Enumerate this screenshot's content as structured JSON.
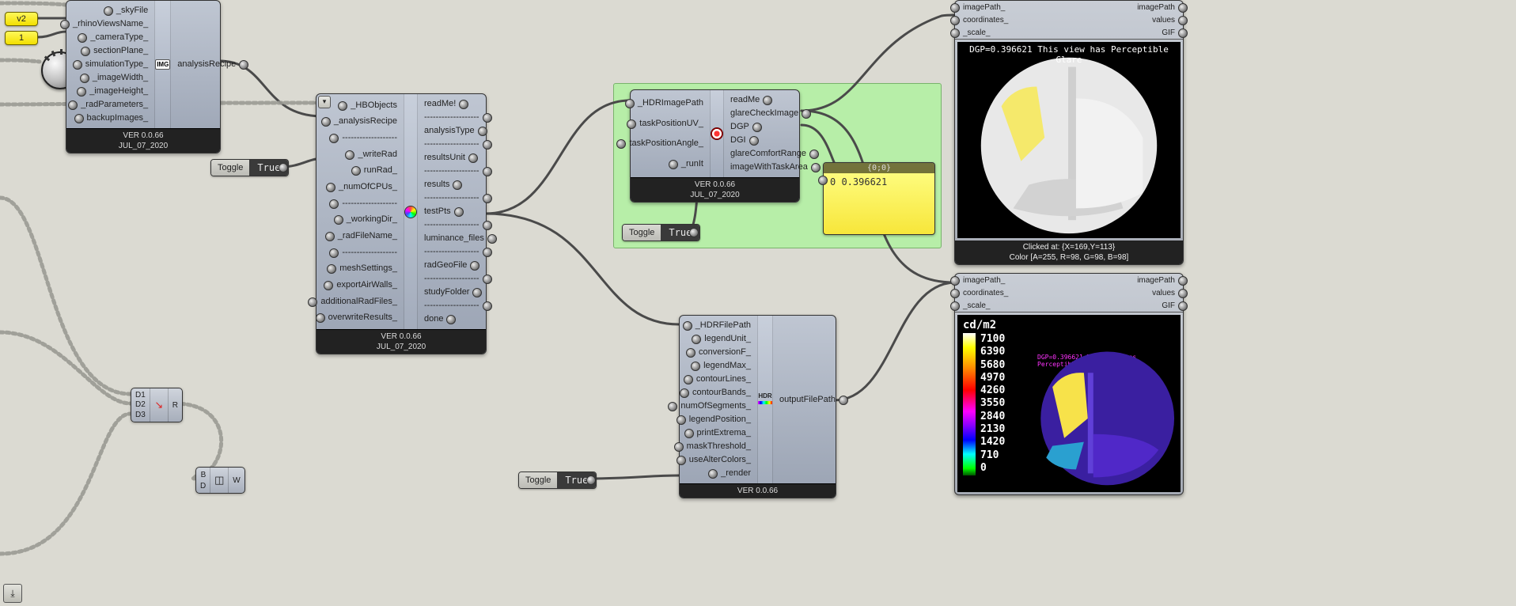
{
  "version": "VER 0.0.66",
  "date": "JUL_07_2020",
  "caps": {
    "v2": "v2",
    "one": "1"
  },
  "toggles": {
    "label": "Toggle",
    "val": "True"
  },
  "node1": {
    "in": [
      "_skyFile",
      "_rhinoViewsName_",
      "_cameraType_",
      "sectionPlane_",
      "simulationType_",
      "_imageWidth_",
      "_imageHeight_",
      "_radParameters_",
      "backupImages_"
    ],
    "out": [
      "analysisRecipe"
    ]
  },
  "node2": {
    "in": [
      "_HBObjects",
      "_analysisRecipe",
      "-------------------",
      "_writeRad",
      "runRad_",
      "_numOfCPUs_",
      "-------------------",
      "_workingDir_",
      "_radFileName_",
      "-------------------",
      "meshSettings_",
      "exportAirWalls_",
      "additionalRadFiles_",
      "overwriteResults_"
    ],
    "out": [
      "readMe!",
      "-------------------",
      "analysisType",
      "-------------------",
      "resultsUnit",
      "-------------------",
      "results",
      "-------------------",
      "testPts",
      "-------------------",
      "luminance_files",
      "-------------------",
      "radGeoFile",
      "-------------------",
      "studyFolder",
      "-------------------",
      "done"
    ]
  },
  "glare": {
    "in": [
      "_HDRImagePath",
      "taskPositionUV_",
      "taskPositionAngle_",
      "_runIt"
    ],
    "out": [
      "readMe",
      "glareCheckImage",
      "DGP",
      "DGI",
      "glareComfortRange",
      "imageWithTaskArea"
    ]
  },
  "falsecolor": {
    "in": [
      "_HDRFilePath",
      "legendUnit_",
      "conversionF_",
      "legendMax_",
      "contourLines_",
      "contourBands_",
      "numOfSegments_",
      "legendPosition_",
      "printExtrema_",
      "maskThreshold_",
      "useAlterColors_",
      "_render"
    ],
    "out": [
      "outputFilePath"
    ]
  },
  "panel": {
    "header": "{0;0}",
    "body": "0 0.396621"
  },
  "merge": {
    "in": [
      "D1",
      "D2",
      "D3"
    ],
    "out": "R"
  },
  "brep": {
    "in": [
      "B",
      "D"
    ],
    "out": "W"
  },
  "viewer": {
    "hdr_rows": [
      [
        "imagePath_",
        "imagePath"
      ],
      [
        "coordinates_",
        "values"
      ],
      [
        "_scale_",
        "GIF"
      ]
    ],
    "top_banner": "DGP=0.396621 This view has Perceptible Glare",
    "click": "Clicked at: {X=169,Y=113}",
    "color": "Color [A=255, R=98, G=98, B=98]",
    "legend_title": "cd/m2",
    "legend_vals": [
      "7100",
      "6390",
      "5680",
      "4970",
      "4260",
      "3550",
      "2840",
      "2130",
      "1420",
      "710",
      "0"
    ],
    "bot_banner": "DGP=0.396621 This view has Perceptible Glare"
  },
  "icon_hdr": "HDR"
}
